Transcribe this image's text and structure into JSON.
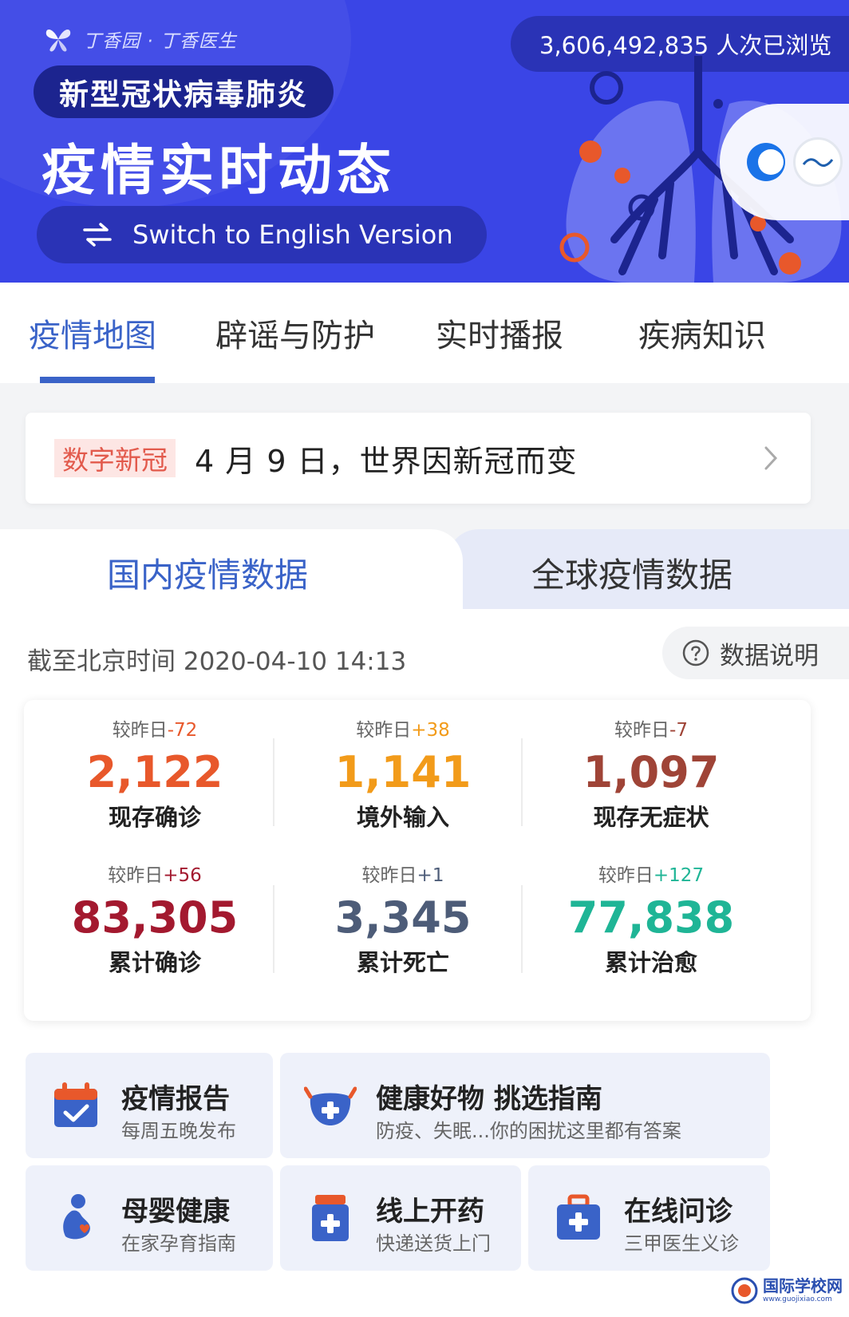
{
  "header": {
    "brand": "丁香园 · 丁香医生",
    "views": "3,606,492,835 人次已浏览",
    "disease": "新型冠状病毒肺炎",
    "title": "疫情实时动态",
    "switch_label": "Switch to English Version",
    "icons": {
      "brand": "butterfly-logo-icon",
      "switch": "swap-arrows-icon",
      "partner": "partner-logo-icon"
    }
  },
  "tabs": [
    {
      "label": "疫情地图",
      "active": true
    },
    {
      "label": "辟谣与防护",
      "active": false
    },
    {
      "label": "实时播报",
      "active": false
    },
    {
      "label": "疾病知识",
      "active": false
    }
  ],
  "news": {
    "tag": "数字新冠",
    "title": "4 月 9 日，世界因新冠而变"
  },
  "data_tabs": [
    {
      "label": "国内疫情数据",
      "active": true
    },
    {
      "label": "全球疫情数据",
      "active": false
    }
  ],
  "as_of": "截至北京时间 2020-04-10 14:13",
  "explain": "数据说明",
  "stats_prefix": "较昨日",
  "stats": [
    {
      "label": "现存确诊",
      "value": "2,122",
      "delta": "-72",
      "color": "#e8582b",
      "delta_color": "#e8582b"
    },
    {
      "label": "境外输入",
      "value": "1,141",
      "delta": "+38",
      "color": "#f29b1a",
      "delta_color": "#f29b1a"
    },
    {
      "label": "现存无症状",
      "value": "1,097",
      "delta": "-7",
      "color": "#9f4437",
      "delta_color": "#9f4437"
    },
    {
      "label": "累计确诊",
      "value": "83,305",
      "delta": "+56",
      "color": "#a3192f",
      "delta_color": "#a3192f"
    },
    {
      "label": "累计死亡",
      "value": "3,345",
      "delta": "+1",
      "color": "#4d5c78",
      "delta_color": "#4d5c78"
    },
    {
      "label": "累计治愈",
      "value": "77,838",
      "delta": "+127",
      "color": "#1fb596",
      "delta_color": "#1fb596"
    }
  ],
  "services": [
    {
      "title": "疫情报告",
      "sub": "每周五晚发布",
      "icon": "calendar-check-icon"
    },
    {
      "title": "健康好物 挑选指南",
      "sub": "防疫、失眠...你的困扰这里都有答案",
      "icon": "mask-icon"
    },
    {
      "title": "母婴健康",
      "sub": "在家孕育指南",
      "icon": "pregnant-woman-icon"
    },
    {
      "title": "线上开药",
      "sub": "快递送货上门",
      "icon": "medicine-bottle-icon"
    },
    {
      "title": "在线问诊",
      "sub": "三甲医生义诊",
      "icon": "medical-kit-icon"
    }
  ],
  "watermark": {
    "name": "国际学校网",
    "url": "www.guojixiao.com"
  },
  "colors": {
    "banner": "#3a45e6",
    "accent": "#3a63c8",
    "tag": "#e25a4c"
  }
}
